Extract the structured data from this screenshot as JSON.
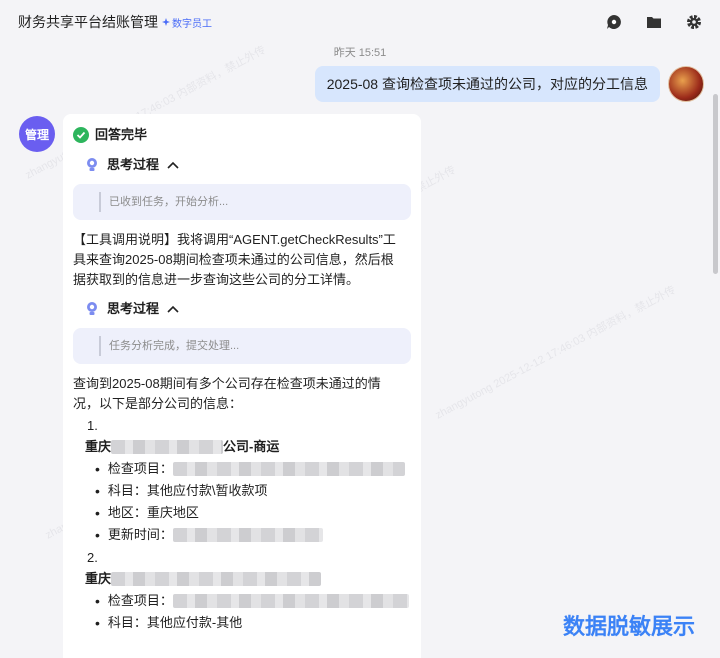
{
  "header": {
    "title": "财务共享平台结账管理",
    "badge": "数字员工",
    "icons": [
      "chat-bubble-icon",
      "folder-icon",
      "gear-icon"
    ]
  },
  "chat": {
    "timestamp": "昨天 15:51",
    "user_message": "2025-08 查询检查项未通过的公司，对应的分工信息",
    "bot_avatar_label": "管理",
    "status": "回答完毕",
    "think_label_1": "思考过程",
    "think_text_1": "已收到任务，开始分析...",
    "tool_explain": "【工具调用说明】我将调用“AGENT.getCheckResults”工具来查询2025-08期间检查项未通过的公司信息，然后根据获取到的信息进一步查询这些公司的分工详情。",
    "think_label_2": "思考过程",
    "think_text_2": "任务分析完成，提交处理...",
    "result_intro": "查询到2025-08期间有多个公司存在检查项未通过的情况，以下是部分公司的信息：",
    "companies": [
      {
        "number": "1.",
        "name_prefix": "重庆",
        "name_suffix": "公司-商运",
        "items": [
          {
            "label": "检查项目：",
            "value": ""
          },
          {
            "label": "科目：",
            "value": "其他应付款\\暂收款项"
          },
          {
            "label": "地区：",
            "value": "重庆地区"
          },
          {
            "label": "更新时间：",
            "value": ""
          }
        ]
      },
      {
        "number": "2.",
        "name_prefix": "重庆",
        "name_suffix": "",
        "items": [
          {
            "label": "检查项目：",
            "value": ""
          },
          {
            "label": "科目：",
            "value": "其他应付款-其他"
          }
        ]
      }
    ]
  },
  "watermark_label": "数据脱敏展示",
  "colors": {
    "accent": "#4a6cf7",
    "user_bubble": "#d7e6fd",
    "bot_avatar": "#6a5ef0",
    "success": "#2db55d"
  }
}
